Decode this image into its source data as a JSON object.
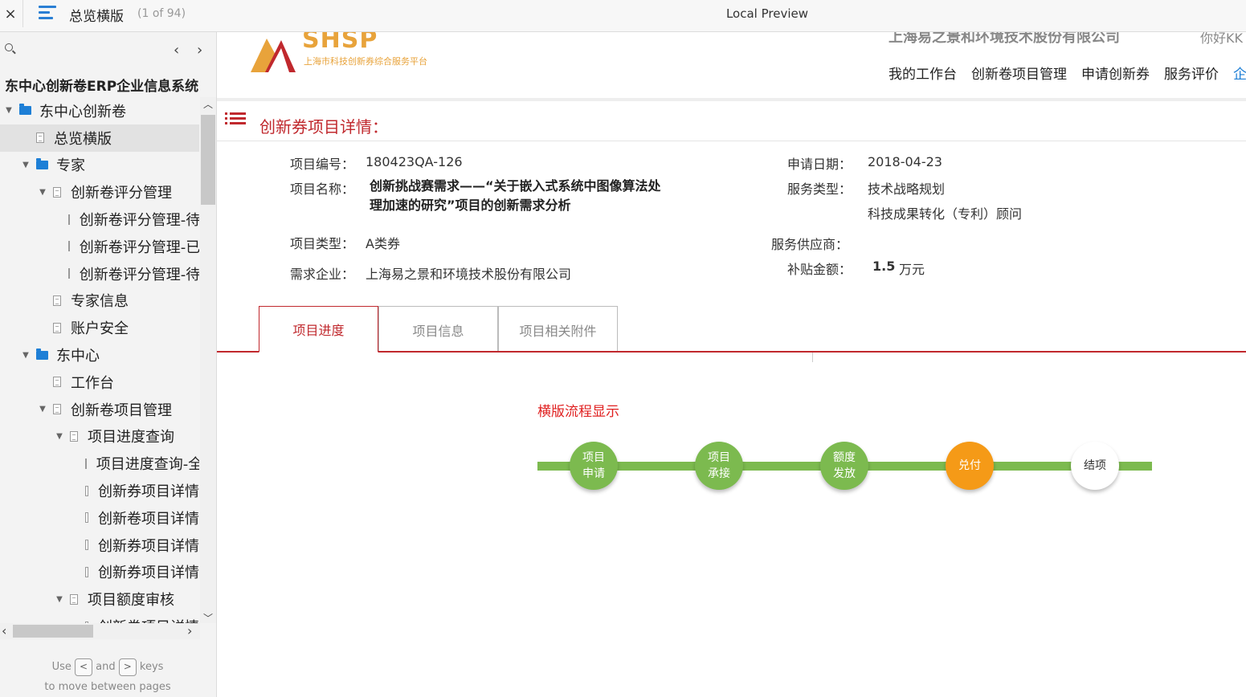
{
  "topbar": {
    "close": "×",
    "title": "总览横版",
    "page_count": "(1 of 94)",
    "preview": "Local Preview"
  },
  "sidebar": {
    "prev": "‹",
    "next": "›",
    "heading": "东中心创新卷ERP企业信息系统",
    "items": [
      {
        "label": "东中心创新卷",
        "type": "folder",
        "level": 0,
        "expanded": true
      },
      {
        "label": "总览横版",
        "type": "page",
        "level": 1,
        "selected": true
      },
      {
        "label": "专家",
        "type": "folder",
        "level": 1,
        "expanded": true
      },
      {
        "label": "创新卷评分管理",
        "type": "page",
        "level": 2,
        "expanded": true
      },
      {
        "label": "创新卷评分管理-待",
        "type": "page",
        "level": 3
      },
      {
        "label": "创新卷评分管理-已",
        "type": "page",
        "level": 3
      },
      {
        "label": "创新卷评分管理-待",
        "type": "page",
        "level": 3
      },
      {
        "label": "专家信息",
        "type": "page",
        "level": 2
      },
      {
        "label": "账户安全",
        "type": "page",
        "level": 2
      },
      {
        "label": "东中心",
        "type": "folder",
        "level": 1,
        "expanded": true
      },
      {
        "label": "工作台",
        "type": "page",
        "level": 2
      },
      {
        "label": "创新卷项目管理",
        "type": "page",
        "level": 2,
        "expanded": true
      },
      {
        "label": "项目进度查询",
        "type": "page",
        "level": 3,
        "expanded": true
      },
      {
        "label": "项目进度查询-全",
        "type": "page",
        "level": 4
      },
      {
        "label": "创新券项目详情",
        "type": "page",
        "level": 4
      },
      {
        "label": "创新卷项目详情",
        "type": "page",
        "level": 4
      },
      {
        "label": "创新券项目详情",
        "type": "page",
        "level": 4
      },
      {
        "label": "创新券项目详情",
        "type": "page",
        "level": 4
      },
      {
        "label": "项目额度审核",
        "type": "page",
        "level": 3,
        "expanded": true
      },
      {
        "label": "创新卷项目详情",
        "type": "page",
        "level": 4
      }
    ],
    "hint_use": "Use",
    "hint_and": "and",
    "hint_keys": "keys",
    "hint_line2": "to move between pages",
    "key_prev": "<",
    "key_next": ">"
  },
  "header": {
    "logo_text": "SHSP",
    "logo_sub": "上海市科技创新券综合服务平台",
    "company": "上海易之景和环境技术股份有限公司",
    "greeting": "你好KK",
    "nav": [
      "我的工作台",
      "创新卷项目管理",
      "申请创新券",
      "服务评价",
      "企"
    ]
  },
  "detail": {
    "title": "创新券项目详情：",
    "fields": {
      "code_label": "项目编号：",
      "code_value": "180423QA-126",
      "name_label": "项目名称：",
      "name_value": "创新挑战赛需求——“关于嵌入式系统中图像算法处理加速的研究”项目的创新需求分析",
      "type_label": "项目类型：",
      "type_value": "A类券",
      "company_label": "需求企业：",
      "company_value": "上海易之景和环境技术股份有限公司",
      "date_label": "申请日期：",
      "date_value": "2018-04-23",
      "service_label": "服务类型：",
      "service_value_1": "技术战略规划",
      "service_value_2": "科技成果转化（专利）顾问",
      "provider_label": "服务供应商：",
      "subsidy_label": "补贴金额：",
      "subsidy_value": "1.5",
      "subsidy_unit": "万元"
    },
    "tabs": [
      "项目进度",
      "项目信息",
      "项目相关附件"
    ],
    "active_tab": 0
  },
  "flow": {
    "title": "横版流程显示",
    "nodes": [
      {
        "line1": "项目",
        "line2": "申请",
        "state": "done"
      },
      {
        "line1": "项目",
        "line2": "承接",
        "state": "done"
      },
      {
        "line1": "额度",
        "line2": "发放",
        "state": "done"
      },
      {
        "line1": "兑付",
        "line2": "",
        "state": "current"
      },
      {
        "line1": "结项",
        "line2": "",
        "state": "pending"
      }
    ]
  },
  "colors": {
    "accent_red": "#c0282d",
    "flow_green": "#7cba4f",
    "flow_orange": "#f59a17",
    "folder_blue": "#1e7fd6",
    "logo_orange": "#e8a33b"
  }
}
